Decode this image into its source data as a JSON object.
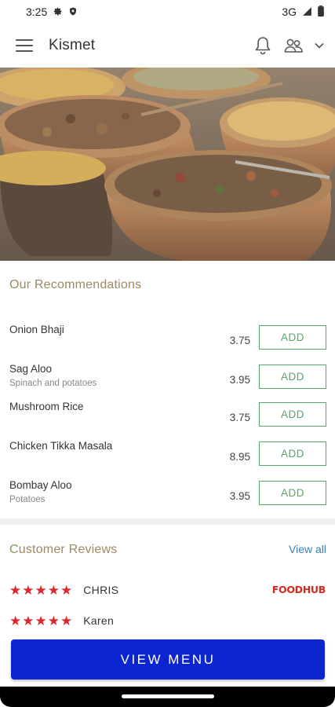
{
  "status_bar": {
    "time": "3:25",
    "network": "3G",
    "icons": [
      "settings-icon",
      "shield-icon",
      "signal-icon",
      "battery-icon"
    ]
  },
  "app_bar": {
    "title": "Kismet",
    "icons": [
      "menu-icon",
      "bell-icon",
      "people-icon",
      "chevron-down-icon"
    ]
  },
  "recommendations": {
    "title": "Our Recommendations",
    "add_label": "ADD",
    "items": [
      {
        "name": "Onion Bhaji",
        "description": "",
        "price": "3.75"
      },
      {
        "name": "Sag Aloo",
        "description": "Spinach and potatoes",
        "price": "3.95"
      },
      {
        "name": "Mushroom Rice",
        "description": "",
        "price": "3.75"
      },
      {
        "name": "Chicken Tikka Masala",
        "description": "",
        "price": "8.95"
      },
      {
        "name": "Bombay Aloo",
        "description": "Potatoes",
        "price": "3.95"
      }
    ]
  },
  "reviews": {
    "title": "Customer Reviews",
    "view_all": "View all",
    "items": [
      {
        "name": "CHRIS",
        "rating": 5,
        "source": "FOODHUB"
      },
      {
        "name": "Karen",
        "rating": 5,
        "source": ""
      }
    ]
  },
  "view_menu_label": "VIEW MENU",
  "colors": {
    "accent_gold": "#9b8a63",
    "add_green": "#57a66a",
    "link_blue": "#3a7fb3",
    "star_red": "#e0262b",
    "button_blue": "#0b25d0"
  }
}
